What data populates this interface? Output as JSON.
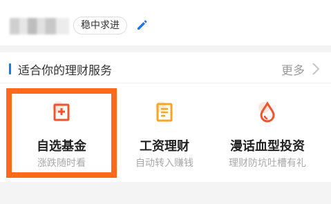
{
  "profile": {
    "tag_label": "稳中求进"
  },
  "services_section": {
    "title": "适合你的理财服务",
    "more_label": "更多",
    "items": [
      {
        "name": "自选基金",
        "subtitle": "涨跌随时看",
        "icon": "plus-doc-icon",
        "icon_color": "#f0542d"
      },
      {
        "name": "工资理财",
        "subtitle": "自动转入赚钱",
        "icon": "document-icon",
        "icon_color": "#f5a623"
      },
      {
        "name": "漫话血型投资",
        "subtitle": "理财防坑吐槽有礼",
        "icon": "drop-icon",
        "icon_color": "#f0542d"
      }
    ]
  },
  "colors": {
    "accent_blue": "#1677ff",
    "highlight_orange": "#ff6a1a"
  }
}
